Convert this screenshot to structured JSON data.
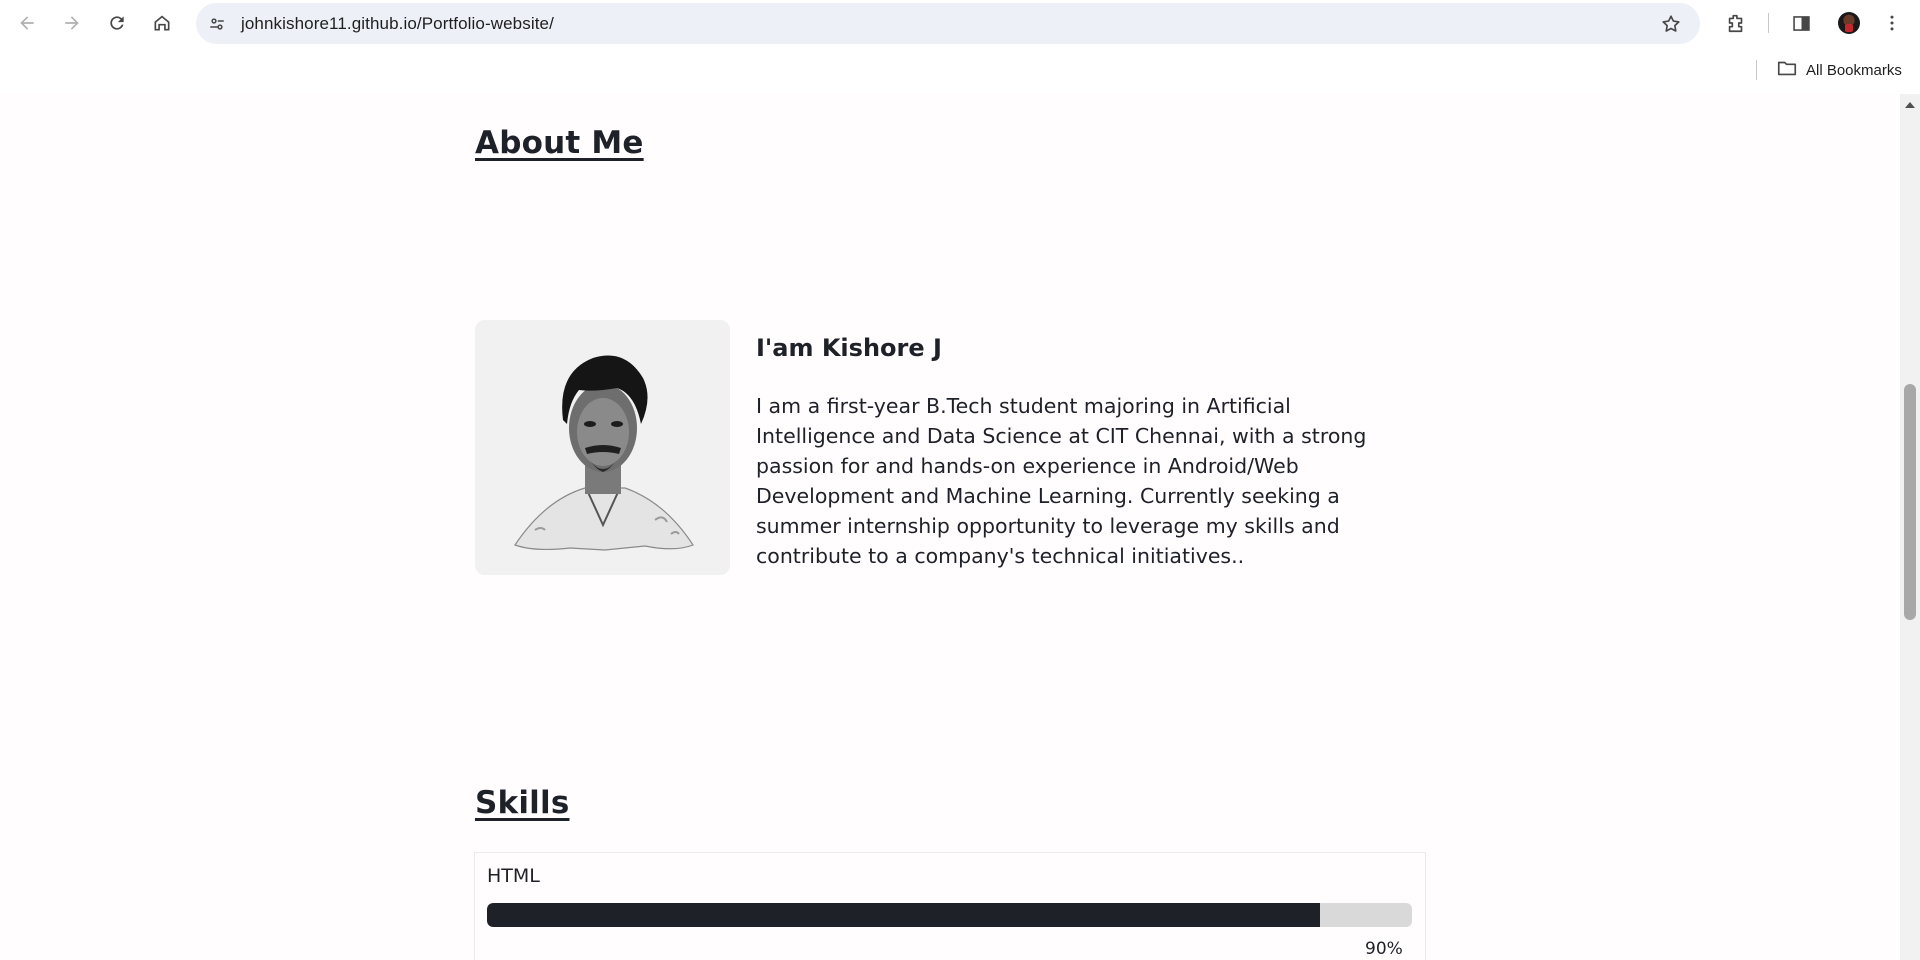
{
  "browser": {
    "url": "johnkishore11.github.io/Portfolio-website/",
    "bookmarks_label": "All Bookmarks",
    "icons": [
      "back-icon",
      "forward-icon",
      "reload-icon",
      "home-icon",
      "site-info-icon",
      "star-icon",
      "extensions-icon",
      "side-panel-icon",
      "profile-avatar",
      "more-menu-icon",
      "folder-icon"
    ]
  },
  "about": {
    "title": "About Me",
    "name": "I'am Kishore J",
    "description": "I am a first-year B.Tech student majoring in Artificial Intelligence and Data Science at CIT Chennai, with a strong passion for and hands-on experience in Android/Web Development and Machine Learning. Currently seeking a summer internship opportunity to leverage my skills and contribute to a company's technical initiatives.."
  },
  "skills": {
    "title": "Skills",
    "items": [
      {
        "name": "HTML",
        "level": 0.9,
        "percent_label": "90%"
      }
    ]
  },
  "colors": {
    "text": "#1f2129",
    "bar_fill": "#1f2129",
    "bar_track": "#d9d9d9",
    "page_bg": "#fffdfd",
    "omnibox_bg": "#eef0f8"
  }
}
